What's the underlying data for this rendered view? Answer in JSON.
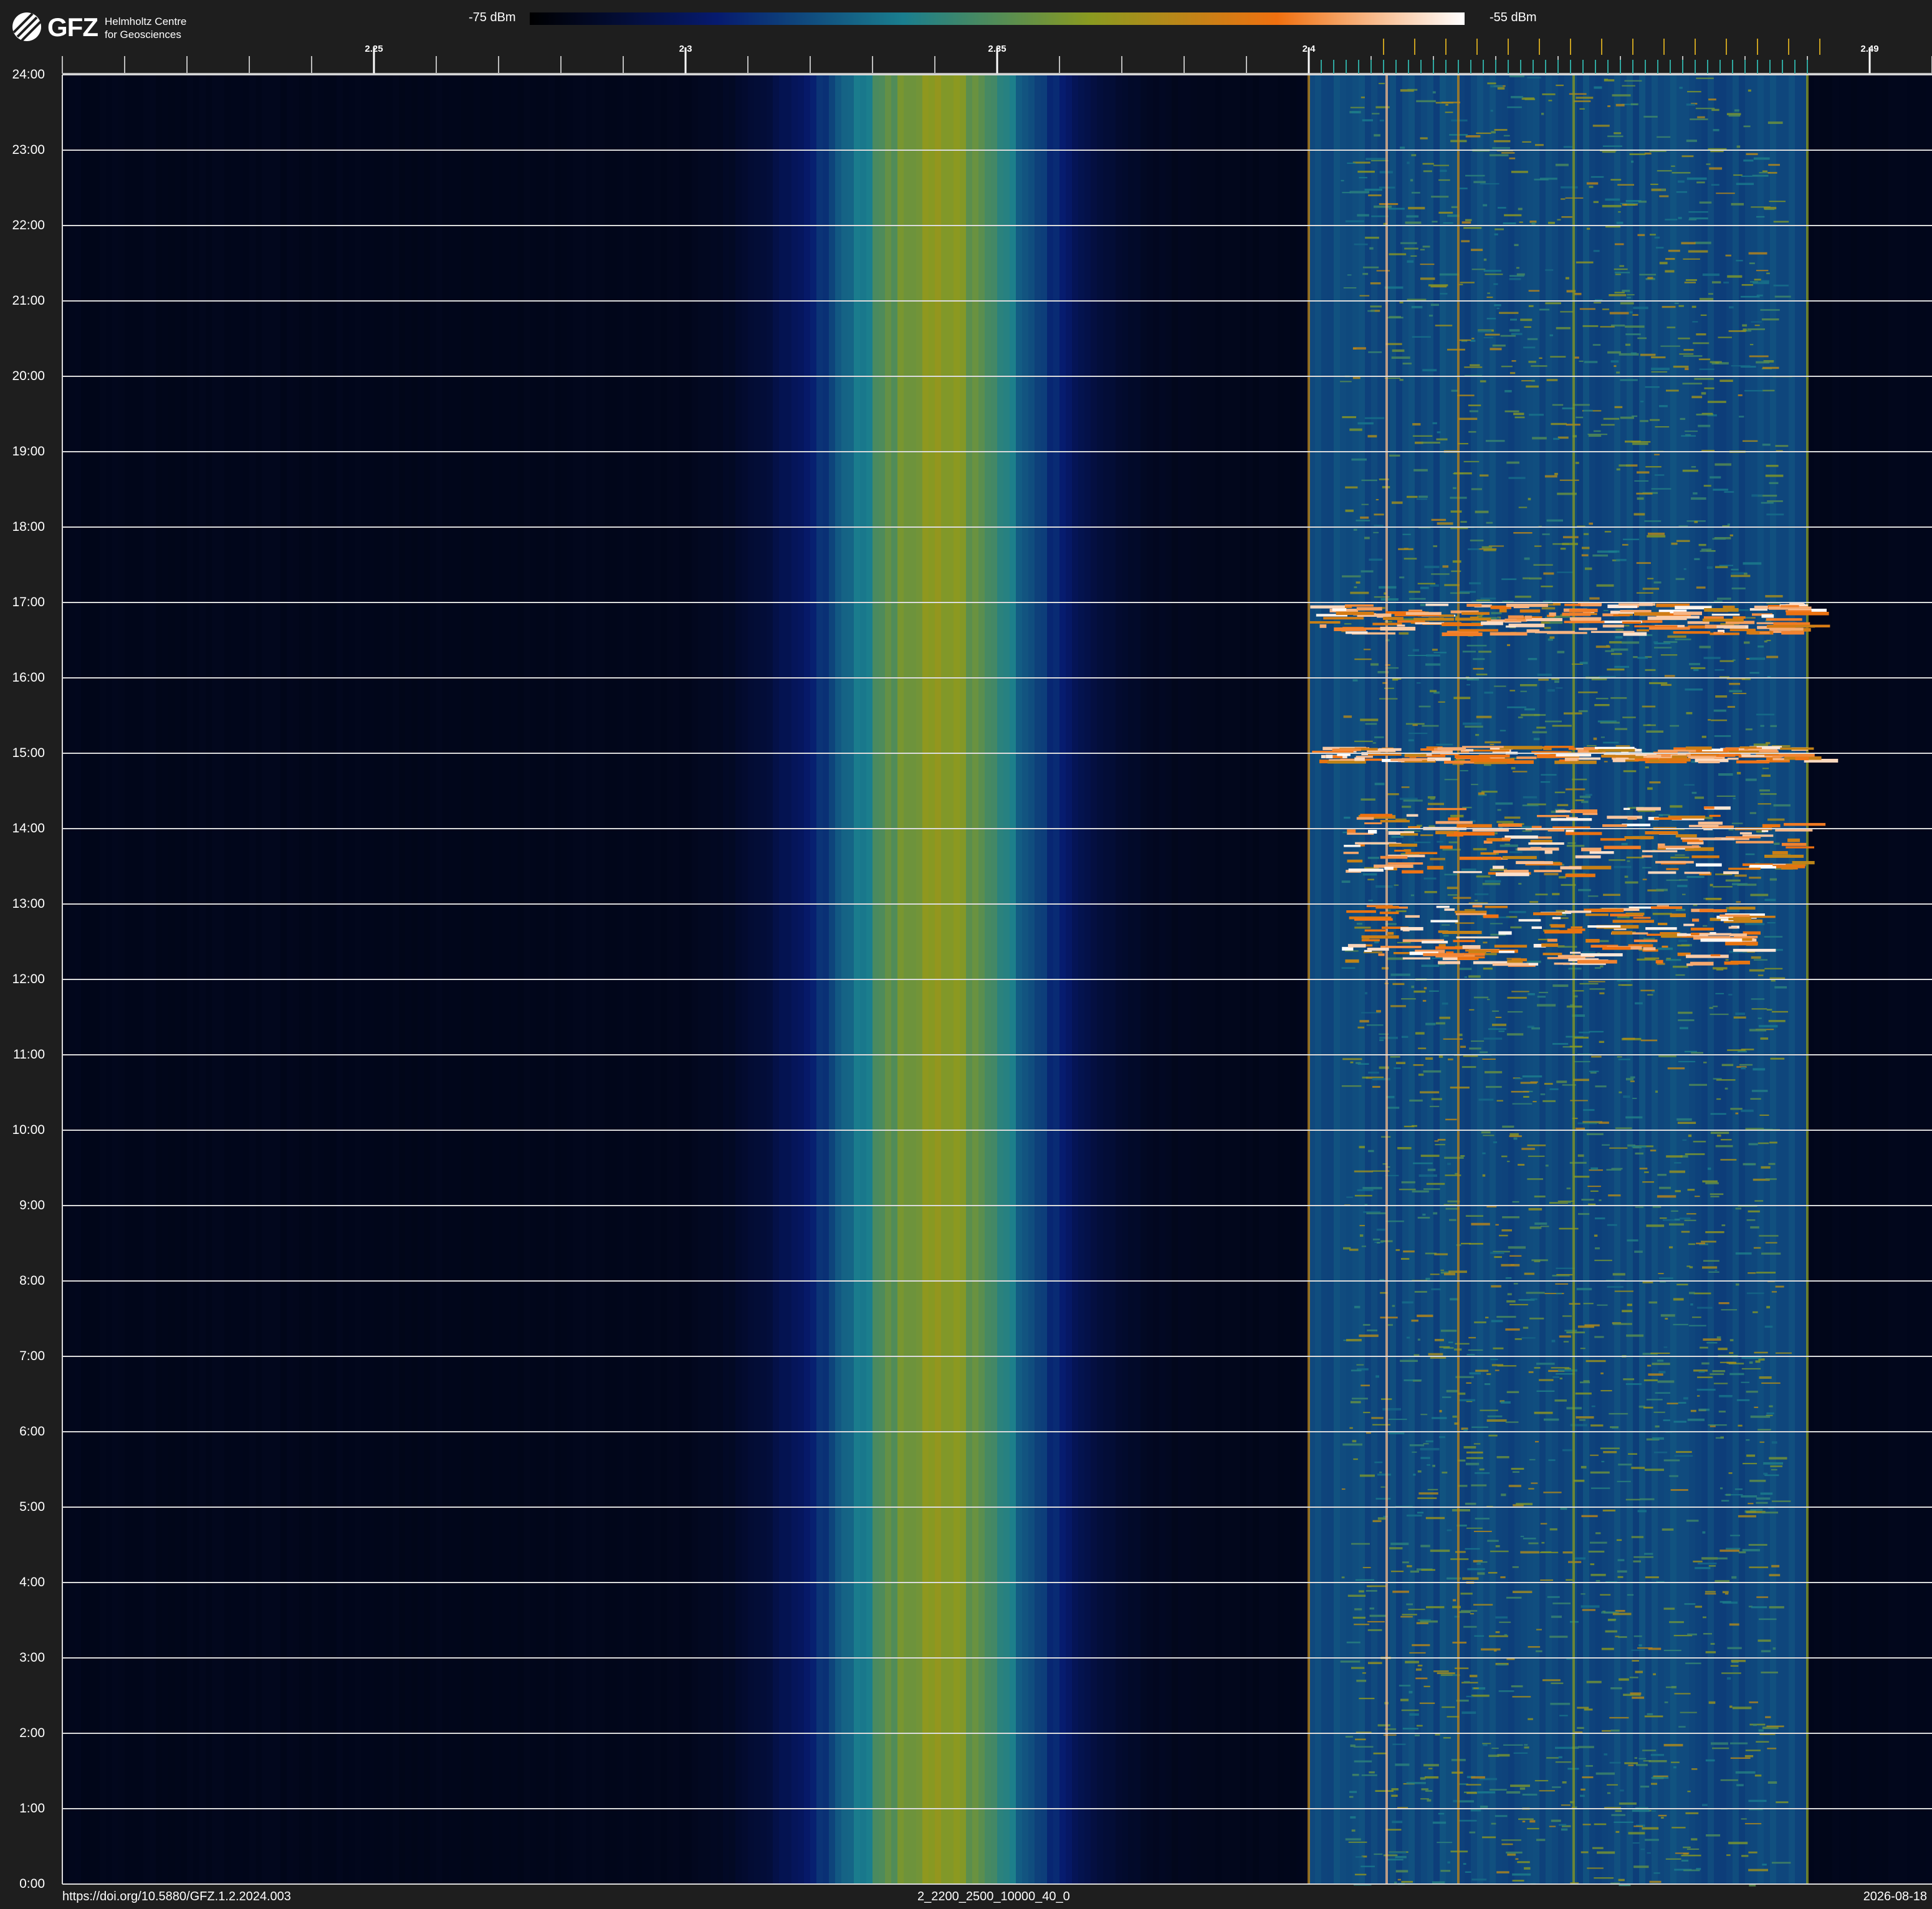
{
  "header": {
    "logo_text": "GFZ",
    "logo_sub_line1": "Helmholtz Centre",
    "logo_sub_line2": "for Geosciences",
    "colorbar_min_label": "-75 dBm",
    "colorbar_max_label": "-55 dBm"
  },
  "footer": {
    "doi": "https://doi.org/10.5880/GFZ.1.2.2024.003",
    "file_id": "2_2200_2500_10000_40_0",
    "date": "2026-08-18"
  },
  "colors": {
    "background": "#1e1e1e",
    "colormap": [
      "#000000",
      "#061a6e",
      "#1a7e8e",
      "#8a9a20",
      "#f07010",
      "#ffffff"
    ]
  },
  "chart_data": {
    "type": "heatmap",
    "title": "",
    "xlabel": "",
    "ylabel": "",
    "x_unit_note": "",
    "xlim": [
      2.2,
      2.5
    ],
    "ylim_hours": [
      0,
      24
    ],
    "x_tick_labels": [
      {
        "value": 2.25,
        "label": "2.25"
      },
      {
        "value": 2.3,
        "label": "2.3"
      },
      {
        "value": 2.35,
        "label": "2.35"
      },
      {
        "value": 2.4,
        "label": "2.4"
      },
      {
        "value": 2.49,
        "label": "2.49"
      }
    ],
    "x_minor_step": 0.01,
    "y_tick_labels": [
      "0:00",
      "1:00",
      "2:00",
      "3:00",
      "4:00",
      "5:00",
      "6:00",
      "7:00",
      "8:00",
      "9:00",
      "10:00",
      "11:00",
      "12:00",
      "13:00",
      "14:00",
      "15:00",
      "16:00",
      "17:00",
      "18:00",
      "19:00",
      "20:00",
      "21:00",
      "22:00",
      "23:00",
      "24:00"
    ],
    "grid": true,
    "colorbar": {
      "min_dbm": -75,
      "max_dbm": -55
    },
    "features": [
      {
        "kind": "noise_hump",
        "center": 2.34,
        "width": 0.02,
        "strength": 0.55
      },
      {
        "kind": "band",
        "from": 2.4,
        "to": 2.48,
        "strength": 0.3
      },
      {
        "kind": "vline",
        "x": 2.4,
        "strength": 0.7
      },
      {
        "kind": "vline",
        "x": 2.4125,
        "strength": 0.9
      },
      {
        "kind": "vline",
        "x": 2.424,
        "strength": 0.7
      },
      {
        "kind": "vline",
        "x": 2.4425,
        "strength": 0.6
      },
      {
        "kind": "vline",
        "x": 2.48,
        "strength": 0.6
      },
      {
        "kind": "burst",
        "hour_from": 16.6,
        "hour_to": 17.0,
        "x_from": 2.4,
        "x_to": 2.48
      },
      {
        "kind": "burst",
        "hour_from": 14.9,
        "hour_to": 15.1,
        "x_from": 2.4,
        "x_to": 2.48
      },
      {
        "kind": "burst",
        "hour_from": 13.4,
        "hour_to": 14.3,
        "x_from": 2.404,
        "x_to": 2.478
      },
      {
        "kind": "burst",
        "hour_from": 12.2,
        "hour_to": 13.0,
        "x_from": 2.405,
        "x_to": 2.47
      }
    ]
  }
}
